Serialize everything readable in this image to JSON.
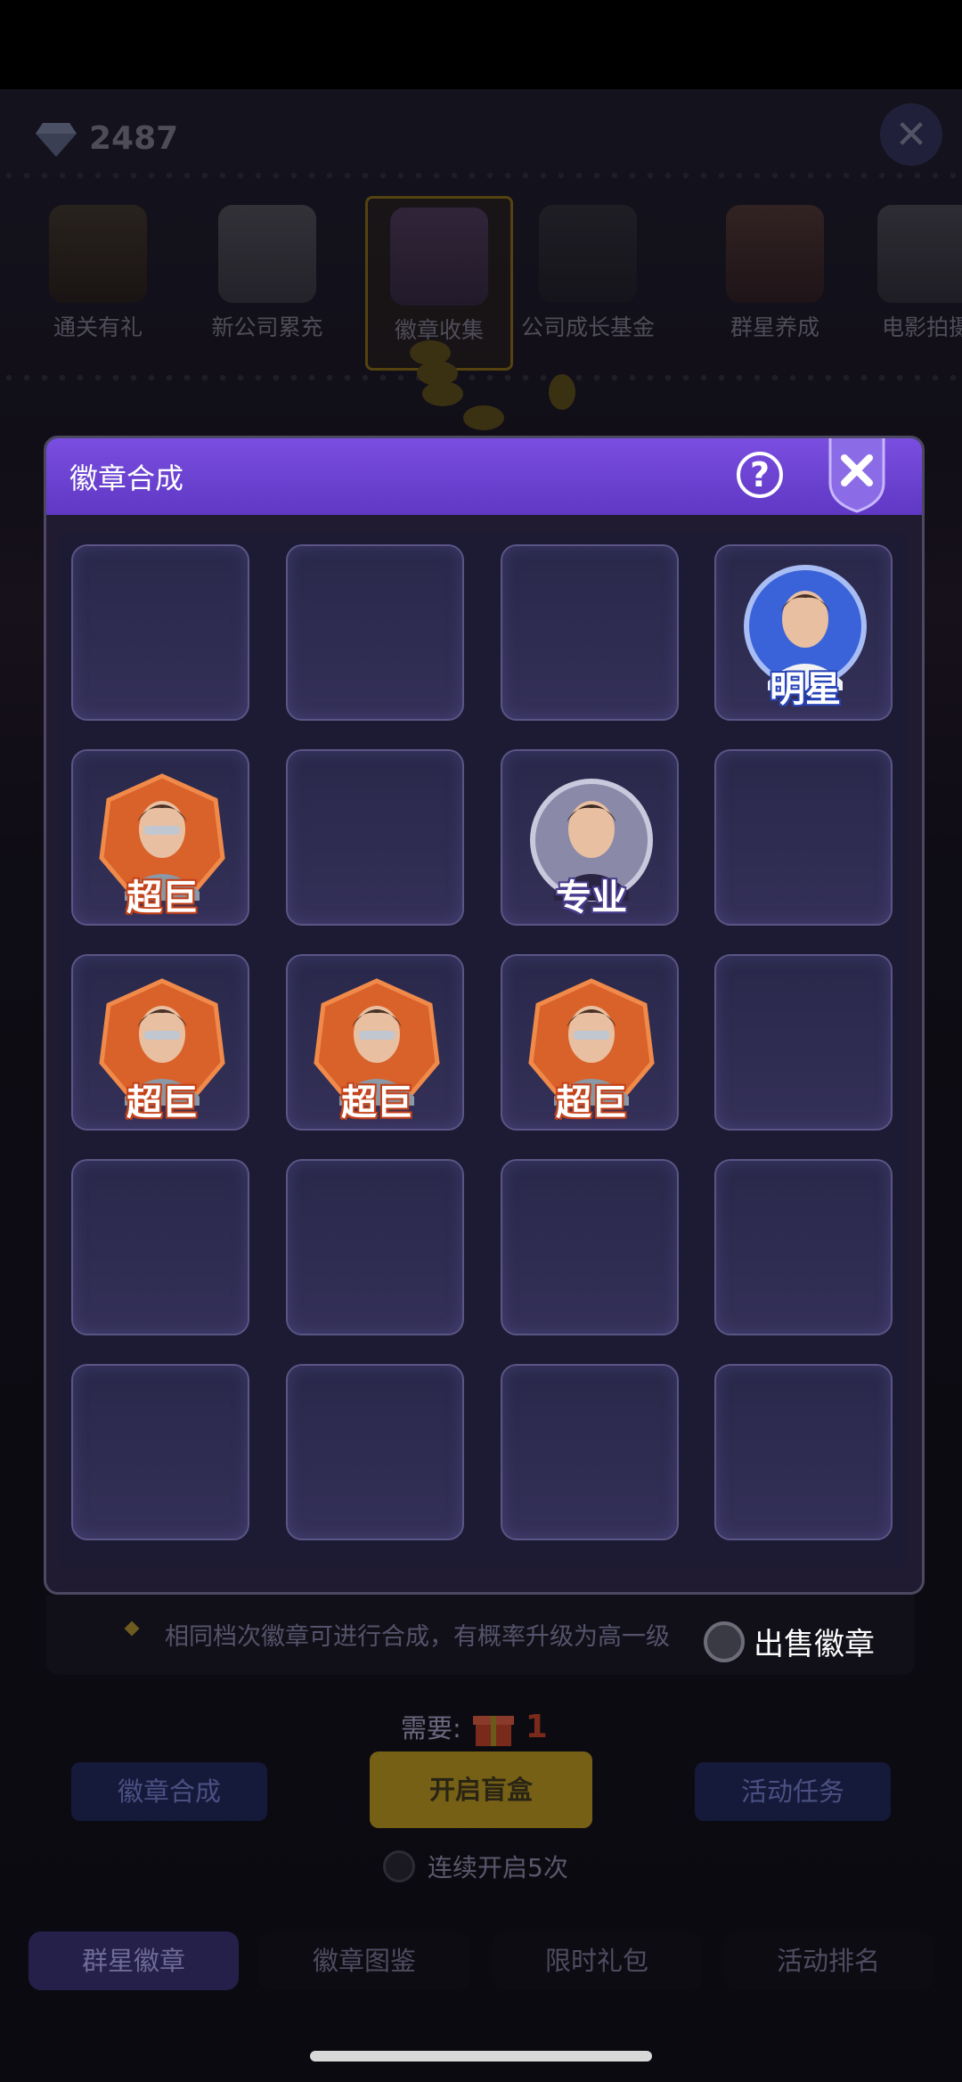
{
  "currency": {
    "value": "2487",
    "icon": "diamond-icon"
  },
  "event_tabs": [
    {
      "label": "通关有礼",
      "icon": "ship-icon"
    },
    {
      "label": "新公司累充",
      "icon": "chest-icon"
    },
    {
      "label": "徽章收集",
      "icon": "badge-icon",
      "active": true
    },
    {
      "label": "公司成长基金",
      "icon": "camera-icon"
    },
    {
      "label": "群星养成",
      "icon": "star-portrait-icon"
    },
    {
      "label": "电影拍摄",
      "icon": "chess-knight-icon"
    }
  ],
  "modal": {
    "title": "徽章合成",
    "help": "?",
    "grid": [
      [
        "",
        "",
        "",
        "明星"
      ],
      [
        "超巨",
        "",
        "专业",
        ""
      ],
      [
        "超巨",
        "超巨",
        "超巨",
        ""
      ],
      [
        "",
        "",
        "",
        ""
      ],
      [
        "",
        "",
        "",
        ""
      ]
    ]
  },
  "hint": "相同档次徽章可进行合成，有概率升级为高一级",
  "sell_label": "出售徽章",
  "need": {
    "label": "需要:",
    "count": "1"
  },
  "actions": {
    "merge": "徽章合成",
    "open": "开启盲盒",
    "tasks": "活动任务"
  },
  "repeat_label": "连续开启5次",
  "bottom_tabs": [
    {
      "label": "群星徽章",
      "active": true
    },
    {
      "label": "徽章图鉴"
    },
    {
      "label": "限时礼包"
    },
    {
      "label": "活动排名"
    }
  ],
  "colors": {
    "header_purple": "#6a42d2",
    "badge_orange": "#d9622a",
    "badge_blue": "#3b63d9",
    "badge_gray": "#8a89a8"
  }
}
